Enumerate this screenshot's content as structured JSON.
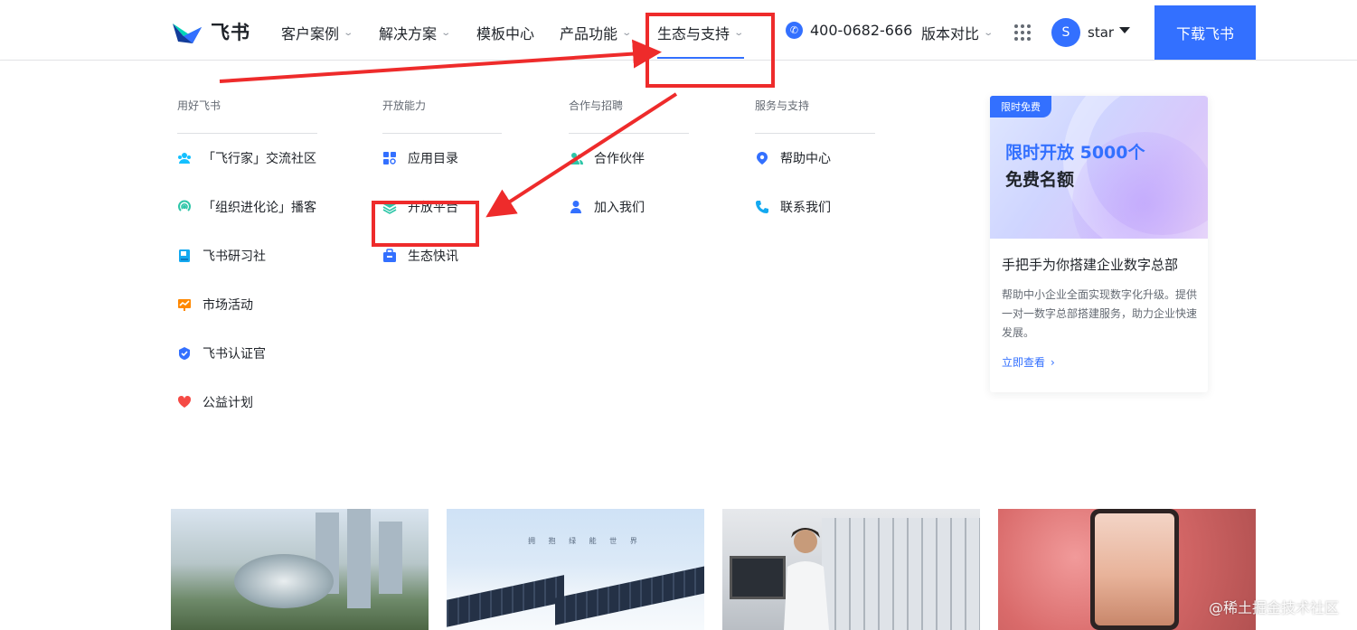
{
  "brand": {
    "name": "飞书"
  },
  "nav": {
    "items": [
      {
        "label": "客户案例",
        "has_dropdown": true
      },
      {
        "label": "解决方案",
        "has_dropdown": true
      },
      {
        "label": "模板中心",
        "has_dropdown": false
      },
      {
        "label": "产品功能",
        "has_dropdown": true
      },
      {
        "label": "生态与支持",
        "has_dropdown": true,
        "active": true
      },
      {
        "label": "版本对比",
        "has_dropdown": true
      }
    ],
    "phone": "400-0682-666",
    "user": {
      "initial": "S",
      "name": "star"
    },
    "download_label": "下载飞书"
  },
  "dropdown": {
    "columns": [
      {
        "header": "用好飞书",
        "items": [
          {
            "label": "「飞行家」交流社区",
            "icon": "community-icon",
            "color": "#14c0ff"
          },
          {
            "label": "「组织进化论」播客",
            "icon": "podcast-icon",
            "color": "#2ec6a8"
          },
          {
            "label": "飞书研习社",
            "icon": "book-icon",
            "color": "#14a9f0"
          },
          {
            "label": "市场活动",
            "icon": "activity-icon",
            "color": "#ff8800"
          },
          {
            "label": "飞书认证官",
            "icon": "badge-icon",
            "color": "#3370ff"
          },
          {
            "label": "公益计划",
            "icon": "heart-icon",
            "color": "#f54a45"
          }
        ]
      },
      {
        "header": "开放能力",
        "items": [
          {
            "label": "应用目录",
            "icon": "app-directory-icon",
            "color": "#3370ff"
          },
          {
            "label": "开放平台",
            "icon": "layers-icon",
            "color": "#2ec6a8"
          },
          {
            "label": "生态快讯",
            "icon": "briefcase-icon",
            "color": "#3370ff"
          }
        ]
      },
      {
        "header": "合作与招聘",
        "items": [
          {
            "label": "合作伙伴",
            "icon": "partners-icon",
            "color": "#2ec6a8"
          },
          {
            "label": "加入我们",
            "icon": "person-icon",
            "color": "#3370ff"
          }
        ]
      },
      {
        "header": "服务与支持",
        "items": [
          {
            "label": "帮助中心",
            "icon": "help-center-icon",
            "color": "#3370ff"
          },
          {
            "label": "联系我们",
            "icon": "phone-icon",
            "color": "#14a9f0"
          }
        ]
      }
    ],
    "promo": {
      "tag": "限时免费",
      "headline_line1": "限时开放 5000个",
      "headline_line2": "免费名额",
      "title": "手把手为你搭建企业数字总部",
      "description": "帮助中小企业全面实现数字化升级。提供一对一数字总部搭建服务，助力企业快速发展。",
      "link": "立即查看"
    }
  },
  "lower": {
    "thumb2_caption": "拥 抱 绿 能 世 界"
  },
  "watermark": "@稀土掘金技术社区",
  "colors": {
    "accent": "#3370ff",
    "annotation": "#ee2b2b"
  }
}
